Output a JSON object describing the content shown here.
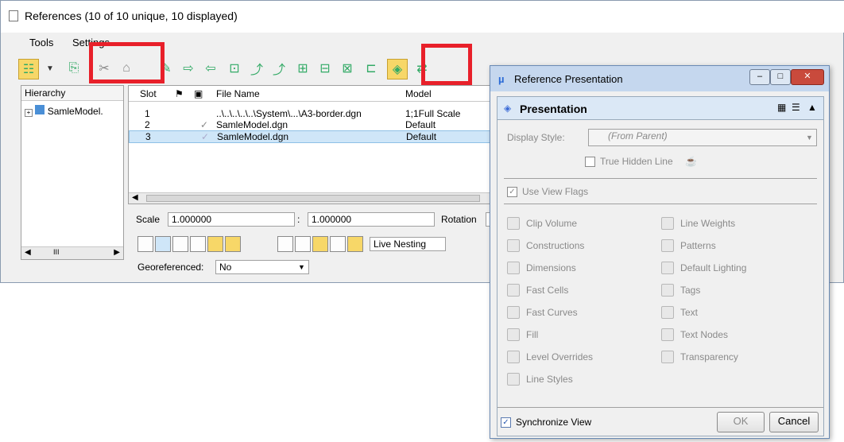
{
  "references_window": {
    "title": "References (10 of 10 unique, 10 displayed)",
    "menu": [
      "Tools",
      "Settings"
    ],
    "tree_header": "Hierarchy",
    "tree_item": "SamleModel.",
    "table_headers": [
      "Slot",
      "File Name",
      "Model"
    ],
    "rows": [
      {
        "slot": "1",
        "check": "",
        "file": "..\\..\\..\\..\\..\\System\\...\\A3-border.dgn",
        "model": "1;1Full Scale"
      },
      {
        "slot": "2",
        "check": "✓",
        "file": "SamleModel.dgn",
        "model": "Default"
      },
      {
        "slot": "3",
        "check": "✓",
        "file": "SamleModel.dgn",
        "model": "Default"
      }
    ],
    "scale_label": "Scale",
    "scale_value_1": "1.000000",
    "scale_sep": ":",
    "scale_value_2": "1.000000",
    "rotation_label": "Rotation",
    "nesting_value": "Live Nesting",
    "georef_label": "Georeferenced:",
    "georef_value": "No",
    "scroll_thumb": "III"
  },
  "dialog": {
    "title": "Reference Presentation",
    "section_title": "Presentation",
    "display_style_label": "Display Style:",
    "display_style_value": "(From Parent)",
    "true_hidden_line": "True Hidden Line",
    "use_view_flags": "Use View Flags",
    "flags_left": [
      "Clip Volume",
      "Constructions",
      "Dimensions",
      "Fast Cells",
      "Fast Curves",
      "Fill",
      "Level Overrides",
      "Line Styles"
    ],
    "flags_right": [
      "Line Weights",
      "Patterns",
      "Default Lighting",
      "Tags",
      "Text",
      "Text Nodes",
      "Transparency"
    ],
    "synchronize_view": "Synchronize View",
    "ok": "OK",
    "cancel": "Cancel"
  },
  "colors": {
    "highlight": "#e8202a",
    "selection": "#cfe6f8"
  }
}
